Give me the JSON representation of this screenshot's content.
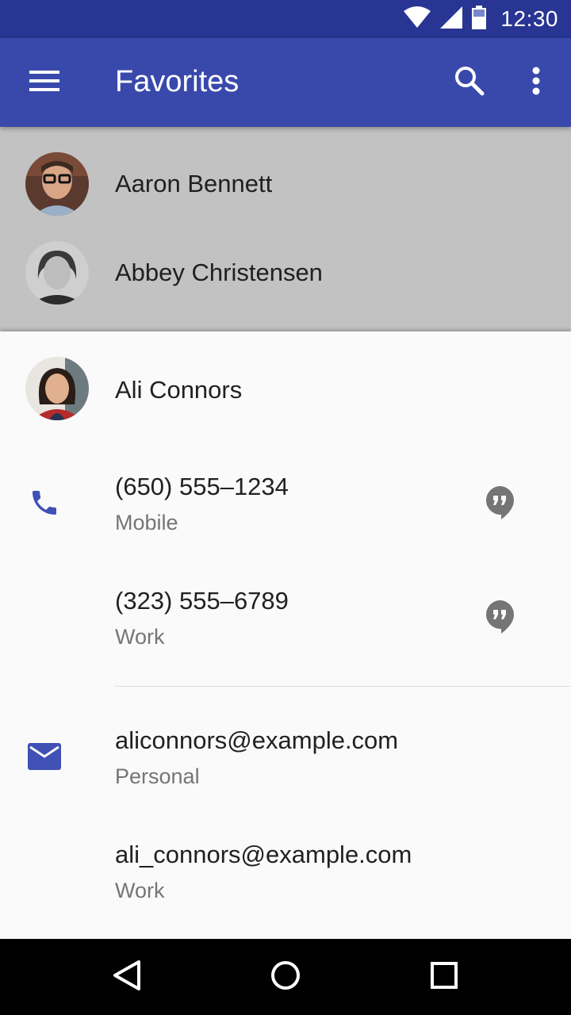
{
  "status_bar": {
    "time": "12:30",
    "icons": [
      "wifi-icon",
      "cell-signal-icon",
      "battery-icon"
    ]
  },
  "app_bar": {
    "title": "Favorites",
    "menu_icon": "menu-icon",
    "search_icon": "search-icon",
    "more_icon": "more-vert-icon",
    "color": "#3949ab",
    "status_color": "#283593"
  },
  "favorites": [
    {
      "name": "Aaron Bennett"
    },
    {
      "name": "Abbey Christensen"
    }
  ],
  "contact_sheet": {
    "name": "Ali Connors",
    "phones": [
      {
        "number": "(650) 555–1234",
        "type": "Mobile"
      },
      {
        "number": "(323) 555–6789",
        "type": "Work"
      }
    ],
    "emails": [
      {
        "address": "aliconnors@example.com",
        "type": "Personal"
      },
      {
        "address": "ali_connors@example.com",
        "type": "Work"
      }
    ],
    "accent_color": "#3f51b5",
    "message_icon": "hangouts-message-icon"
  },
  "nav_bar": {
    "buttons": [
      "back-icon",
      "home-icon",
      "recents-icon"
    ]
  }
}
